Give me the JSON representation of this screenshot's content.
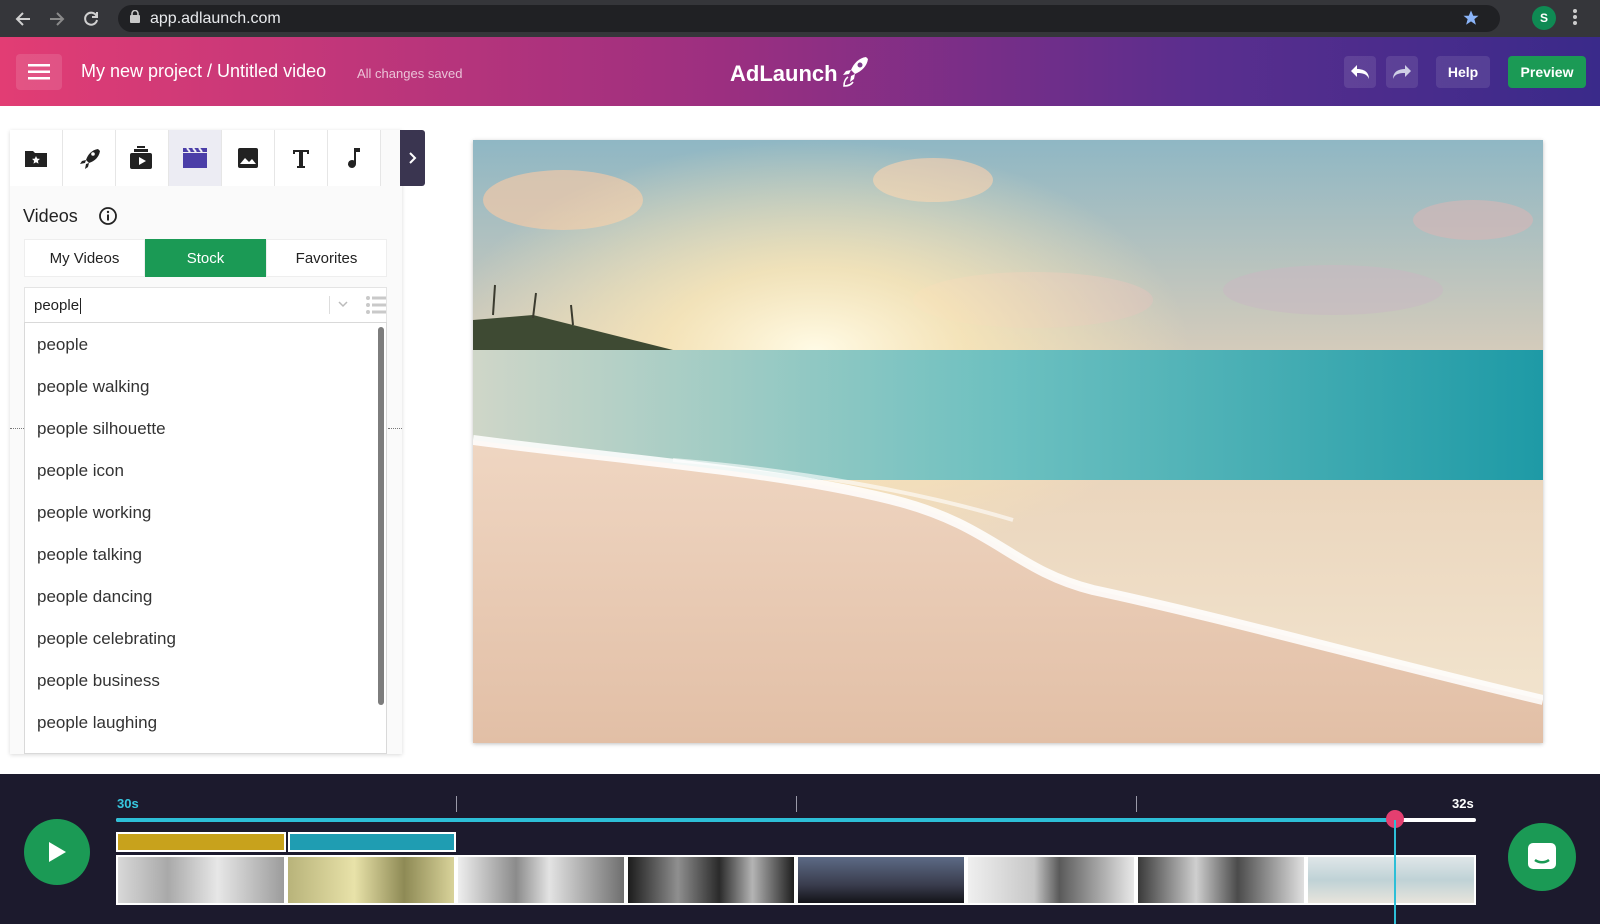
{
  "browser": {
    "url": "app.adlaunch.com",
    "profile_initial": "S"
  },
  "header": {
    "project_title": "My new project / Untitled video",
    "save_status": "All changes saved",
    "logo_text": "AdLaunch",
    "help_label": "Help",
    "preview_label": "Preview"
  },
  "colors": {
    "accent_green": "#1b9a55",
    "timeline_cyan": "#2dbfd7",
    "playhead_pink": "#e43f70",
    "header_gradient_start": "#e23d74",
    "header_gradient_end": "#3a2a8a"
  },
  "toolbar": {
    "tools": [
      "folder-star-icon",
      "rocket-icon",
      "media-library-icon",
      "video-clapper-icon",
      "image-icon",
      "text-icon",
      "music-note-icon"
    ],
    "active_tool": "video-clapper-icon"
  },
  "panel": {
    "section_title": "Videos",
    "tabs": [
      {
        "label": "My Videos",
        "active": false
      },
      {
        "label": "Stock",
        "active": true
      },
      {
        "label": "Favorites",
        "active": false
      }
    ],
    "search_value": "people",
    "suggestions": [
      "people",
      "people walking",
      "people silhouette",
      "people icon",
      "people working",
      "people talking",
      "people dancing",
      "people celebrating",
      "people business",
      "people laughing"
    ]
  },
  "timeline": {
    "start_label": "30s",
    "end_label": "32s",
    "progress": 0.94
  }
}
